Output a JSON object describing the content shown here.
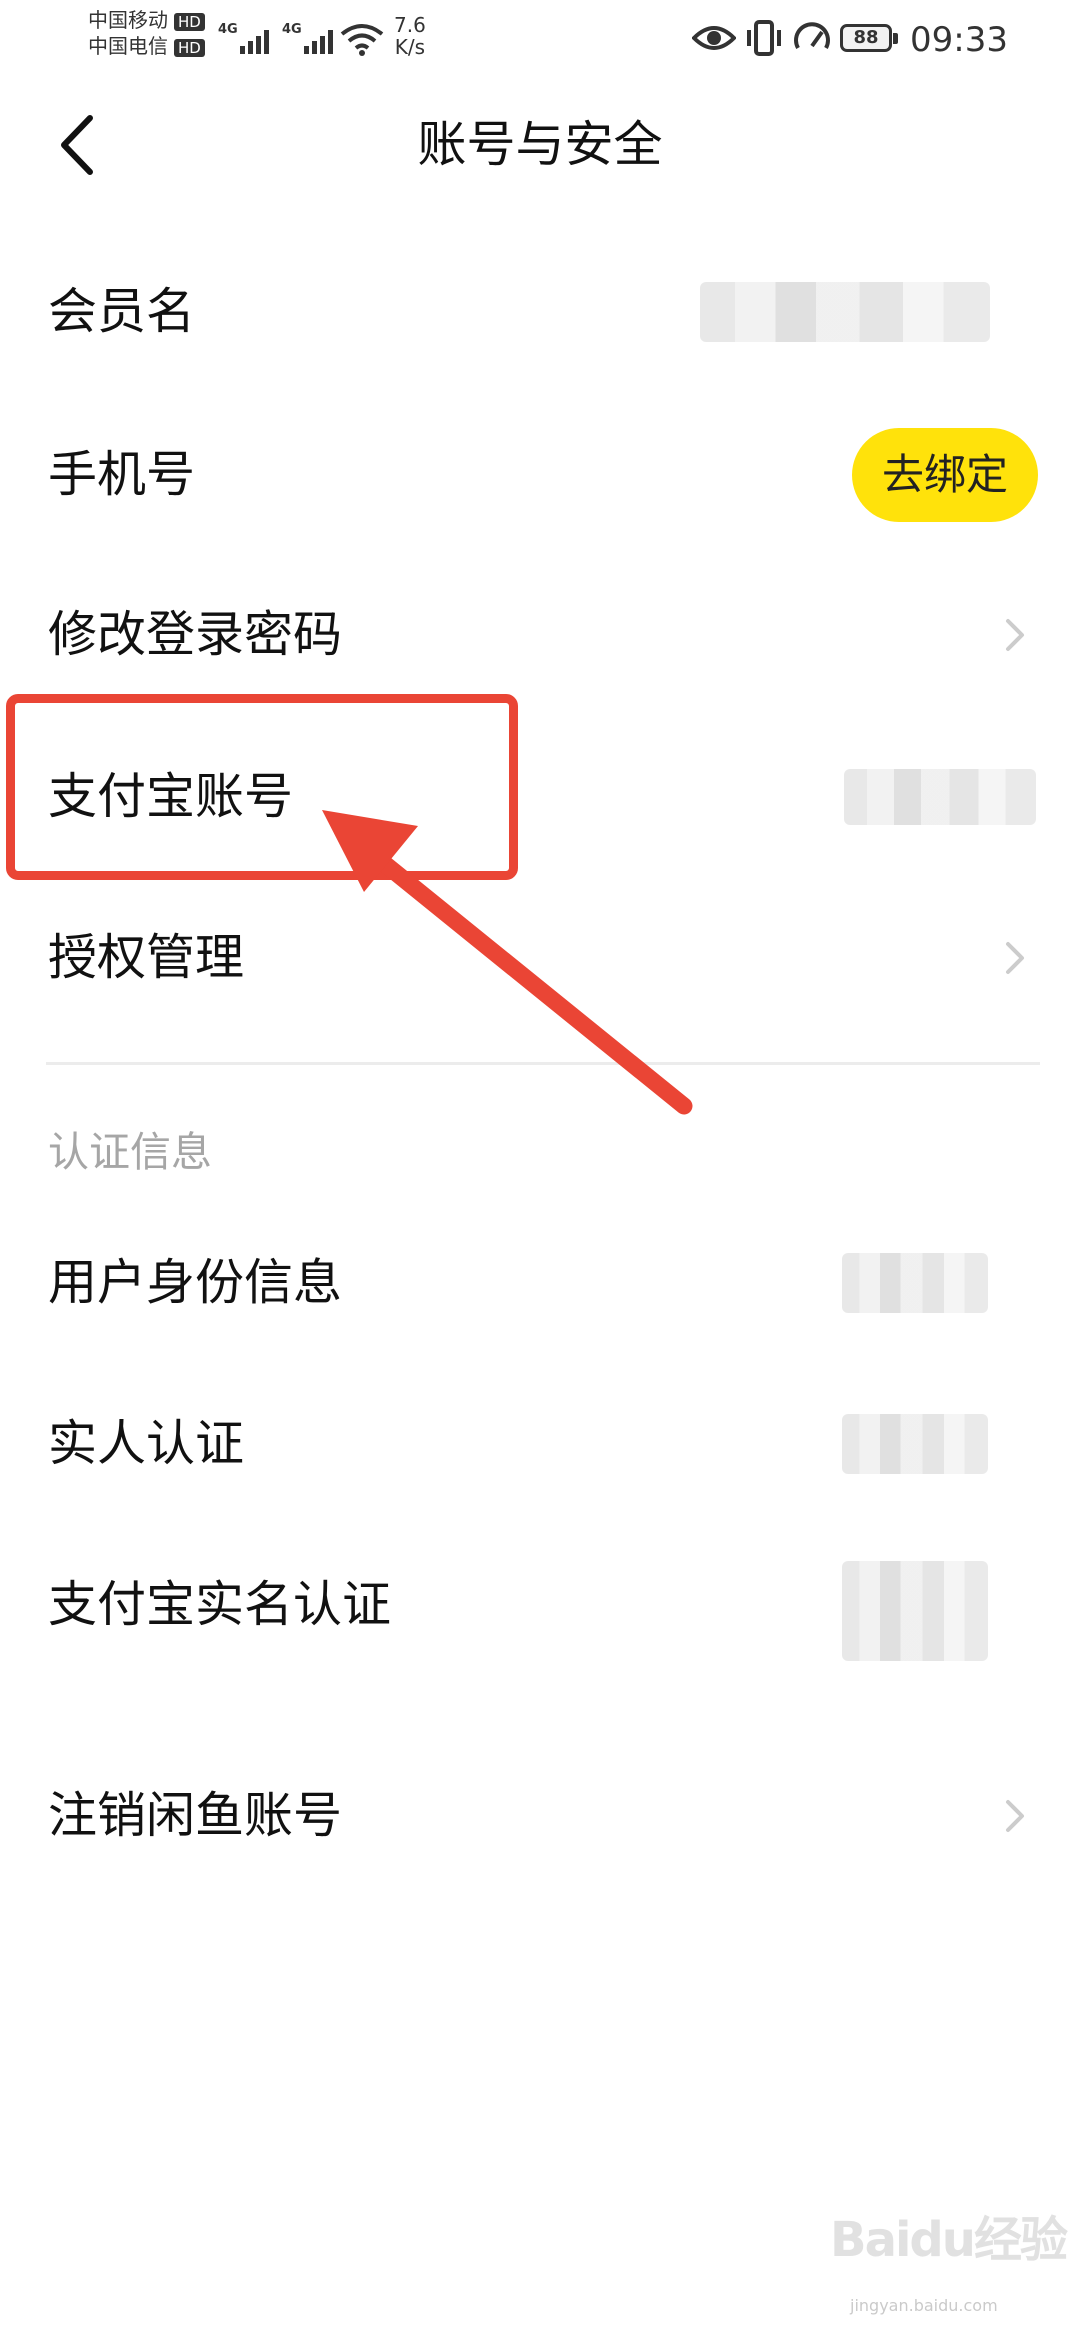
{
  "status_bar": {
    "carrier1": "中国移动",
    "carrier2": "中国电信",
    "hd_badge": "HD",
    "net_type": "4G",
    "speed_value": "7.6",
    "speed_unit": "K/s",
    "battery": "88",
    "time": "09:33",
    "icons": [
      "eye-icon",
      "vibrate-icon",
      "speed-gauge-icon",
      "wifi-icon",
      "signal-icon",
      "battery-icon"
    ]
  },
  "nav": {
    "title": "账号与安全",
    "back_icon": "chevron-left-icon"
  },
  "rows": {
    "member_name": "会员名",
    "phone": "手机号",
    "phone_action": "去绑定",
    "change_password": "修改登录密码",
    "alipay_account": "支付宝账号",
    "authorization": "授权管理"
  },
  "section": {
    "title": "认证信息"
  },
  "auth_rows": {
    "identity": "用户身份信息",
    "real_person": "实人认证",
    "alipay_realname": "支付宝实名认证"
  },
  "bottom": {
    "cancel_account": "注销闲鱼账号"
  },
  "annotation": {
    "color": "#ea4535"
  },
  "accent": "#ffe20b",
  "watermark": {
    "text": "Baidu经验",
    "url": "jingyan.baidu.com"
  }
}
